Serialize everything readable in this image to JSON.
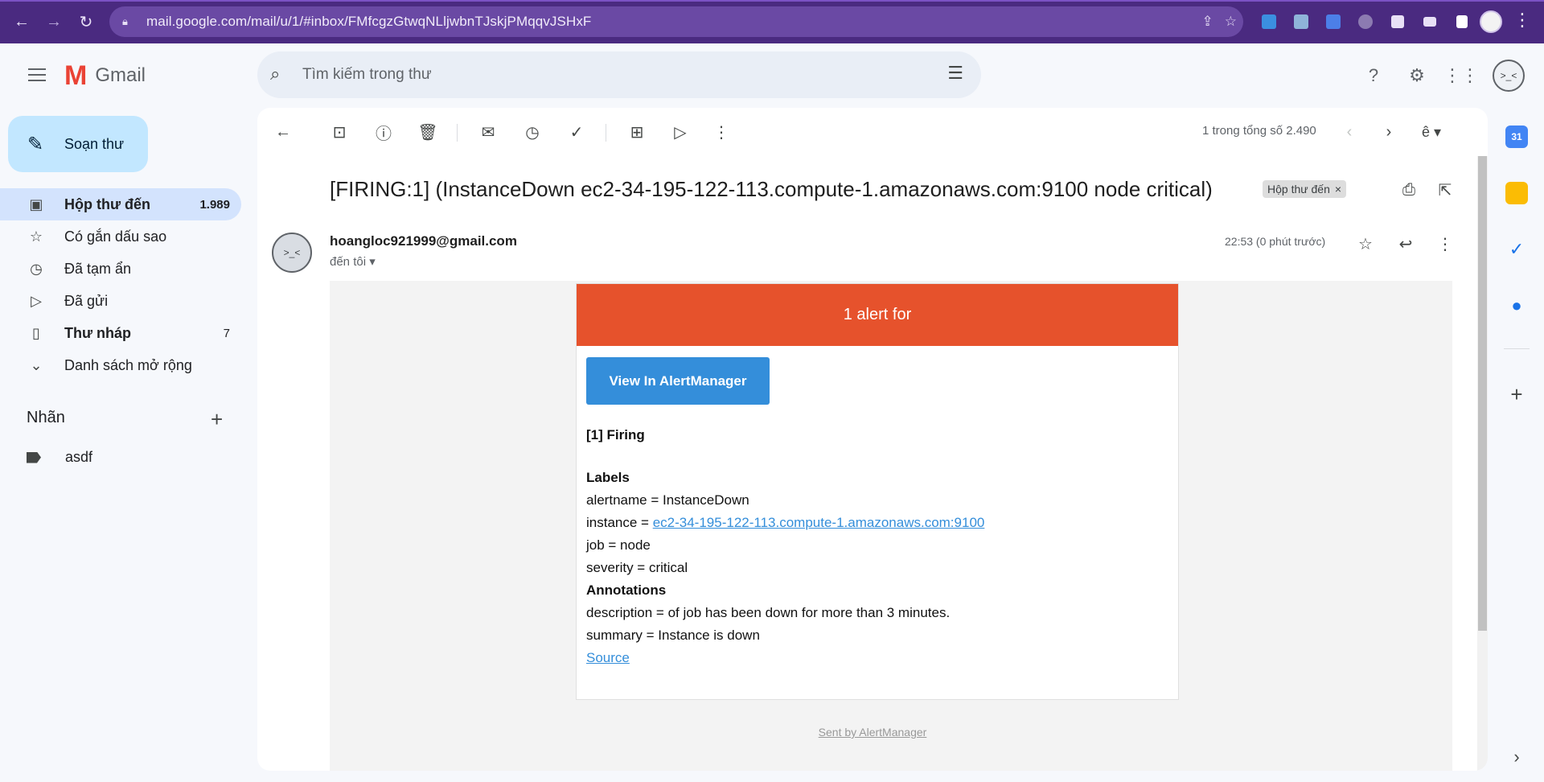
{
  "browser": {
    "url": "mail.google.com/mail/u/1/#inbox/FMfcgzGtwqNLljwbnTJskjPMqqvJSHxF"
  },
  "header": {
    "app_name": "Gmail",
    "search_placeholder": "Tìm kiếm trong thư"
  },
  "sidebar": {
    "compose_label": "Soạn thư",
    "items": [
      {
        "label": "Hộp thư đến",
        "count": "1.989",
        "icon": "inbox-icon"
      },
      {
        "label": "Có gắn dấu sao",
        "count": "",
        "icon": "star-icon"
      },
      {
        "label": "Đã tạm ẩn",
        "count": "",
        "icon": "clock-icon"
      },
      {
        "label": "Đã gửi",
        "count": "",
        "icon": "send-icon"
      },
      {
        "label": "Thư nháp",
        "count": "7",
        "icon": "draft-icon"
      },
      {
        "label": "Danh sách mở rộng",
        "count": "",
        "icon": "chevron-down-icon"
      }
    ],
    "labels_heading": "Nhãn",
    "labels": [
      {
        "label": "asdf"
      }
    ]
  },
  "toolbar": {
    "pager_text": "1 trong tổng số 2.490",
    "input_tool": "ê"
  },
  "message": {
    "subject": "[FIRING:1] (InstanceDown ec2-34-195-122-113.compute-1.amazonaws.com:9100 node critical)",
    "chip_label": "Hộp thư đến",
    "sender": "hoangloc921999@gmail.com",
    "recipient": "đến tôi",
    "timestamp": "22:53 (0 phút trước)"
  },
  "email": {
    "header_text": "1 alert for",
    "button_label": "View In AlertManager",
    "firing_heading": "[1] Firing",
    "labels_heading": "Labels",
    "alertname": "alertname = InstanceDown",
    "instance_prefix": "instance = ",
    "instance_link": "ec2-34-195-122-113.compute-1.amazonaws.com:9100",
    "job": "job = node",
    "severity": "severity = critical",
    "annotations_heading": "Annotations",
    "description": "description = of job has been down for more than 3 minutes.",
    "summary": "summary = Instance is down",
    "source_link": "Source",
    "footer": "Sent by AlertManager"
  },
  "colors": {
    "browser_bar": "#4a2a80",
    "alert_header": "#e6522c",
    "button": "#348eda",
    "active_nav": "#d3e3fd",
    "compose": "#c2e7ff"
  }
}
